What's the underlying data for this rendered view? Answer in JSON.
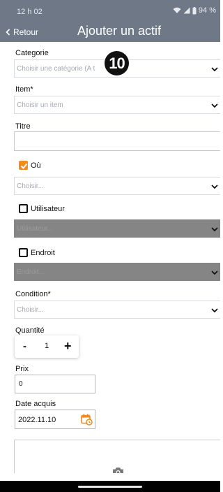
{
  "status_bar": {
    "time": "12 h 02",
    "battery": "94 %"
  },
  "app_bar": {
    "back_label": "Retour",
    "title": "Ajouter un actif"
  },
  "form": {
    "category": {
      "label": "Categorie",
      "placeholder": "Choisir une catégorie (A t"
    },
    "item": {
      "label": "Item*",
      "placeholder": "Choisir un item"
    },
    "title": {
      "label": "Titre",
      "value": ""
    },
    "location_check": {
      "label": "Où",
      "checked": true
    },
    "location": {
      "placeholder": "Choisir..."
    },
    "user_check": {
      "label": "Utilisateur",
      "checked": false
    },
    "user": {
      "placeholder": "Utilisateur...",
      "disabled": true
    },
    "place_check": {
      "label": "Endroit",
      "checked": false
    },
    "place": {
      "placeholder": "Endroit...",
      "disabled": true
    },
    "condition": {
      "label": "Condition*",
      "placeholder": "Choisir..."
    },
    "quantity": {
      "label": "Quantité",
      "minus": "-",
      "value": "1",
      "plus": "+"
    },
    "price": {
      "label": "Prix",
      "value": "0"
    },
    "date": {
      "label": "Date acquis",
      "value": "2022.11.10"
    }
  },
  "badge": {
    "text": "10"
  },
  "colors": {
    "header": "#6f7886",
    "accent": "#f28b1d",
    "disabled": "#858585"
  },
  "icons": [
    "back-chevron-icon",
    "wifi-icon",
    "signal-icon",
    "battery-icon",
    "chevron-down-icon",
    "checkbox-icon",
    "calendar-clock-icon",
    "camera-icon"
  ]
}
